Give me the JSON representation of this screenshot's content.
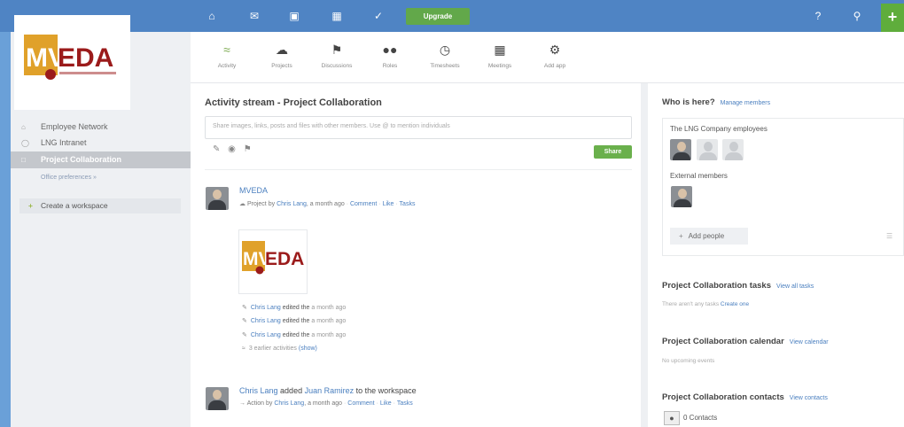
{
  "topbar": {
    "brand": "",
    "upgrade_label": "Upgrade",
    "icons": [
      "home-icon",
      "mail-icon",
      "contacts-icon",
      "calendar-icon",
      "tasks-icon",
      "help-icon",
      "search-icon"
    ],
    "add_label": "+"
  },
  "logo": {
    "text_mv": "MV",
    "text_eda": "EDA"
  },
  "sidebar": {
    "items": [
      {
        "label": "Employee Network",
        "icon": "home-icon"
      },
      {
        "label": "LNG Intranet",
        "icon": "globe-icon"
      },
      {
        "label": "Project Collaboration",
        "icon": "folder-icon"
      }
    ],
    "sub_link": "Office preferences »",
    "create_workspace": "Create a workspace"
  },
  "apps": [
    {
      "label": "Activity",
      "icon": "activity-icon"
    },
    {
      "label": "Projects",
      "icon": "projects-icon"
    },
    {
      "label": "Discussions",
      "icon": "flag-icon"
    },
    {
      "label": "Roles",
      "icon": "people-icon"
    },
    {
      "label": "Timesheets",
      "icon": "clock-icon"
    },
    {
      "label": "Meetings",
      "icon": "calendar-icon"
    },
    {
      "label": "Add app",
      "icon": "gear-icon"
    }
  ],
  "stream": {
    "title": "Activity stream - Project Collaboration",
    "share_placeholder": "Share images, links, posts and files with other members. Use @ to mention individuals",
    "share_button": "Share"
  },
  "post1": {
    "name": "MVEDA",
    "type": "Project",
    "by": "by",
    "author": "Chris Lang",
    "time": ", a month ago",
    "actions": [
      "Comment",
      "Like",
      "Tasks"
    ],
    "activities": [
      {
        "author": "Chris Lang",
        "text": "edited the",
        "time": "a month ago"
      },
      {
        "author": "Chris Lang",
        "text": "edited the",
        "time": "a month ago"
      },
      {
        "author": "Chris Lang",
        "text": "edited the",
        "time": "a month ago"
      }
    ],
    "earlier": "3 earlier activities",
    "earlier_link": "(show)"
  },
  "post2": {
    "author": "Chris Lang",
    "verb": "added",
    "target": "Juan Ramirez",
    "suffix": "to the workspace",
    "type": "Action",
    "by": "by",
    "time": ", a month ago",
    "actions": [
      "Comment",
      "Like",
      "Tasks"
    ]
  },
  "right": {
    "who_title": "Who is here?",
    "manage_members": "Manage members",
    "employees_label": "The LNG Company employees",
    "external_label": "External members",
    "add_people": "Add people",
    "tasks_title": "Project Collaboration tasks",
    "tasks_link": "View all tasks",
    "tasks_empty": "There aren't any tasks",
    "tasks_create": "Create one",
    "calendar_title": "Project Collaboration calendar",
    "calendar_link": "View calendar",
    "calendar_empty": "No upcoming events",
    "contacts_title": "Project Collaboration contacts",
    "contacts_link": "View contacts",
    "contacts_count": "0 Contacts"
  },
  "colors": {
    "topbar": "#4f84c4",
    "accent_green": "#6ab04c",
    "logo_orange": "#e0a12a",
    "logo_red": "#9b1b1b",
    "link": "#4a7fbf"
  }
}
